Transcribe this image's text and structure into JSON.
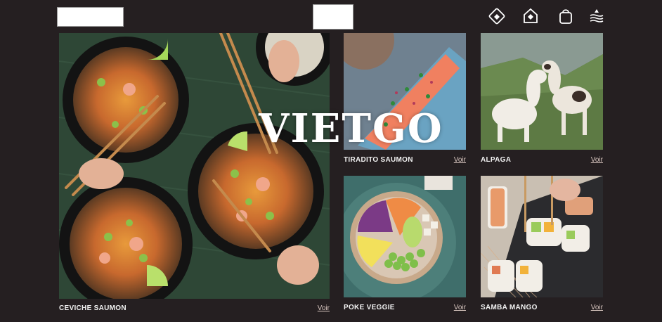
{
  "header": {
    "icons": [
      "diamond-logo-icon",
      "home-shield-icon",
      "bag-icon",
      "menu-waves-icon"
    ]
  },
  "watermark": "VIETGO",
  "dishes": [
    {
      "name": "CEVICHE SAUMON",
      "link": "Voir"
    },
    {
      "name": "TIRADITO SAUMON",
      "link": "Voir"
    },
    {
      "name": "ALPAGA",
      "link": "Voir"
    },
    {
      "name": "POKE VEGGIE",
      "link": "Voir"
    },
    {
      "name": "SAMBA MANGO",
      "link": "Voir"
    }
  ],
  "colors": {
    "background": "#251f21",
    "link": "#d9c7c0"
  }
}
